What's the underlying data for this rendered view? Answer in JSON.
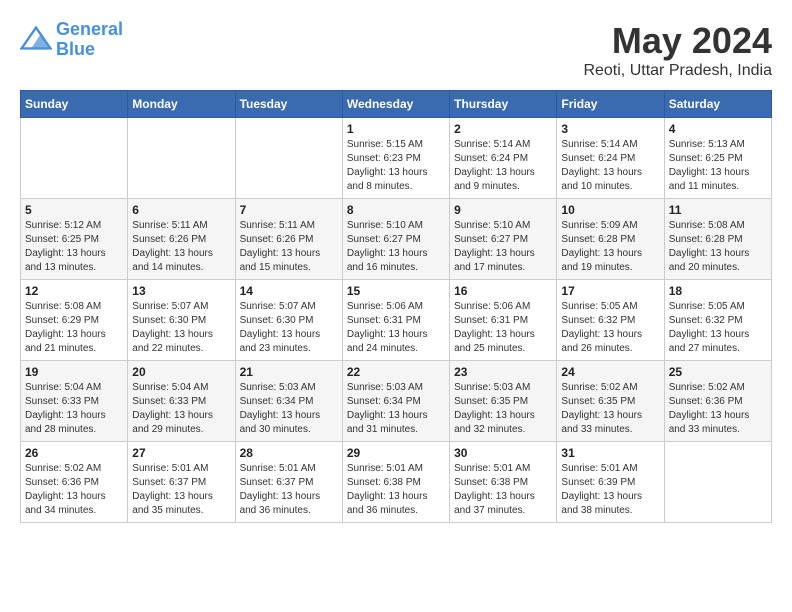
{
  "header": {
    "logo_line1": "General",
    "logo_line2": "Blue",
    "title": "May 2024",
    "subtitle": "Reoti, Uttar Pradesh, India"
  },
  "calendar": {
    "days_of_week": [
      "Sunday",
      "Monday",
      "Tuesday",
      "Wednesday",
      "Thursday",
      "Friday",
      "Saturday"
    ],
    "weeks": [
      [
        {
          "day": "",
          "info": ""
        },
        {
          "day": "",
          "info": ""
        },
        {
          "day": "",
          "info": ""
        },
        {
          "day": "1",
          "info": "Sunrise: 5:15 AM\nSunset: 6:23 PM\nDaylight: 13 hours\nand 8 minutes."
        },
        {
          "day": "2",
          "info": "Sunrise: 5:14 AM\nSunset: 6:24 PM\nDaylight: 13 hours\nand 9 minutes."
        },
        {
          "day": "3",
          "info": "Sunrise: 5:14 AM\nSunset: 6:24 PM\nDaylight: 13 hours\nand 10 minutes."
        },
        {
          "day": "4",
          "info": "Sunrise: 5:13 AM\nSunset: 6:25 PM\nDaylight: 13 hours\nand 11 minutes."
        }
      ],
      [
        {
          "day": "5",
          "info": "Sunrise: 5:12 AM\nSunset: 6:25 PM\nDaylight: 13 hours\nand 13 minutes."
        },
        {
          "day": "6",
          "info": "Sunrise: 5:11 AM\nSunset: 6:26 PM\nDaylight: 13 hours\nand 14 minutes."
        },
        {
          "day": "7",
          "info": "Sunrise: 5:11 AM\nSunset: 6:26 PM\nDaylight: 13 hours\nand 15 minutes."
        },
        {
          "day": "8",
          "info": "Sunrise: 5:10 AM\nSunset: 6:27 PM\nDaylight: 13 hours\nand 16 minutes."
        },
        {
          "day": "9",
          "info": "Sunrise: 5:10 AM\nSunset: 6:27 PM\nDaylight: 13 hours\nand 17 minutes."
        },
        {
          "day": "10",
          "info": "Sunrise: 5:09 AM\nSunset: 6:28 PM\nDaylight: 13 hours\nand 19 minutes."
        },
        {
          "day": "11",
          "info": "Sunrise: 5:08 AM\nSunset: 6:28 PM\nDaylight: 13 hours\nand 20 minutes."
        }
      ],
      [
        {
          "day": "12",
          "info": "Sunrise: 5:08 AM\nSunset: 6:29 PM\nDaylight: 13 hours\nand 21 minutes."
        },
        {
          "day": "13",
          "info": "Sunrise: 5:07 AM\nSunset: 6:30 PM\nDaylight: 13 hours\nand 22 minutes."
        },
        {
          "day": "14",
          "info": "Sunrise: 5:07 AM\nSunset: 6:30 PM\nDaylight: 13 hours\nand 23 minutes."
        },
        {
          "day": "15",
          "info": "Sunrise: 5:06 AM\nSunset: 6:31 PM\nDaylight: 13 hours\nand 24 minutes."
        },
        {
          "day": "16",
          "info": "Sunrise: 5:06 AM\nSunset: 6:31 PM\nDaylight: 13 hours\nand 25 minutes."
        },
        {
          "day": "17",
          "info": "Sunrise: 5:05 AM\nSunset: 6:32 PM\nDaylight: 13 hours\nand 26 minutes."
        },
        {
          "day": "18",
          "info": "Sunrise: 5:05 AM\nSunset: 6:32 PM\nDaylight: 13 hours\nand 27 minutes."
        }
      ],
      [
        {
          "day": "19",
          "info": "Sunrise: 5:04 AM\nSunset: 6:33 PM\nDaylight: 13 hours\nand 28 minutes."
        },
        {
          "day": "20",
          "info": "Sunrise: 5:04 AM\nSunset: 6:33 PM\nDaylight: 13 hours\nand 29 minutes."
        },
        {
          "day": "21",
          "info": "Sunrise: 5:03 AM\nSunset: 6:34 PM\nDaylight: 13 hours\nand 30 minutes."
        },
        {
          "day": "22",
          "info": "Sunrise: 5:03 AM\nSunset: 6:34 PM\nDaylight: 13 hours\nand 31 minutes."
        },
        {
          "day": "23",
          "info": "Sunrise: 5:03 AM\nSunset: 6:35 PM\nDaylight: 13 hours\nand 32 minutes."
        },
        {
          "day": "24",
          "info": "Sunrise: 5:02 AM\nSunset: 6:35 PM\nDaylight: 13 hours\nand 33 minutes."
        },
        {
          "day": "25",
          "info": "Sunrise: 5:02 AM\nSunset: 6:36 PM\nDaylight: 13 hours\nand 33 minutes."
        }
      ],
      [
        {
          "day": "26",
          "info": "Sunrise: 5:02 AM\nSunset: 6:36 PM\nDaylight: 13 hours\nand 34 minutes."
        },
        {
          "day": "27",
          "info": "Sunrise: 5:01 AM\nSunset: 6:37 PM\nDaylight: 13 hours\nand 35 minutes."
        },
        {
          "day": "28",
          "info": "Sunrise: 5:01 AM\nSunset: 6:37 PM\nDaylight: 13 hours\nand 36 minutes."
        },
        {
          "day": "29",
          "info": "Sunrise: 5:01 AM\nSunset: 6:38 PM\nDaylight: 13 hours\nand 36 minutes."
        },
        {
          "day": "30",
          "info": "Sunrise: 5:01 AM\nSunset: 6:38 PM\nDaylight: 13 hours\nand 37 minutes."
        },
        {
          "day": "31",
          "info": "Sunrise: 5:01 AM\nSunset: 6:39 PM\nDaylight: 13 hours\nand 38 minutes."
        },
        {
          "day": "",
          "info": ""
        }
      ]
    ]
  }
}
